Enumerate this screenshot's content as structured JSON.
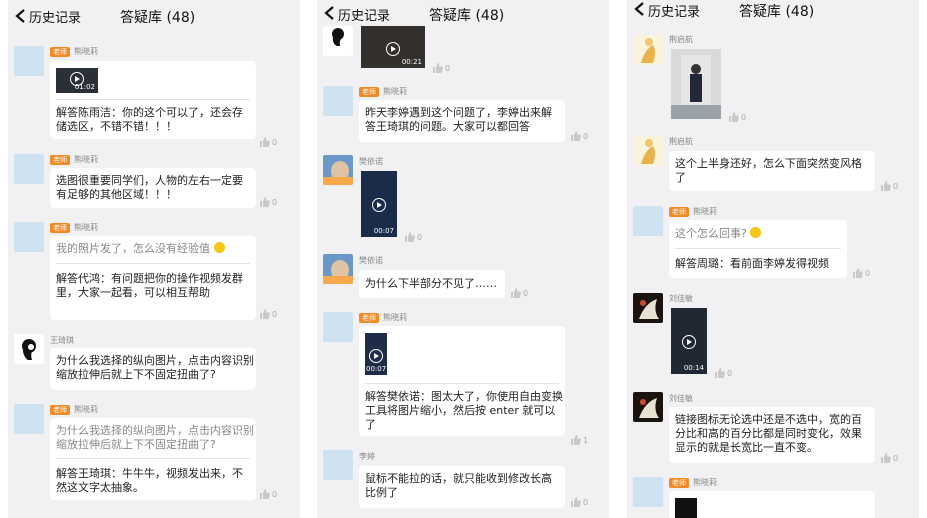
{
  "header": {
    "back_label": "历史记录",
    "title": "答疑库 (48)"
  },
  "teacher_tag": "老师",
  "like_count": "0",
  "panel1": {
    "items": [
      {
        "name": "熊晓莉",
        "video_duration": "01:02",
        "answer": "解答陈雨洁：你的这个可以了，还会存储选区，不错不错！！！",
        "likes": "0"
      },
      {
        "name": "熊晓莉",
        "text": "选图很重要同学们，人物的左右一定要有足够的其他区域！！！",
        "likes": "0"
      },
      {
        "name": "熊晓莉",
        "question": "我的照片发了，怎么没有经验值",
        "answer": "解答代鸿：有问题把你的操作视频发群里，大家一起看，可以相互帮助",
        "likes": "0"
      },
      {
        "name": "王琦琪",
        "text": "为什么我选择的纵向图片，点击内容识别缩放拉伸后就上下不固定扭曲了?"
      },
      {
        "name": "熊晓莉",
        "question": "为什么我选择的纵向图片，点击内容识别缩放拉伸后就上下不固定扭曲了?",
        "answer": "解答王琦琪：牛牛牛，视频发出来，不然这文字太抽象。",
        "likes": "0"
      }
    ]
  },
  "panel2": {
    "items": [
      {
        "video_duration": "00:21",
        "likes": "0"
      },
      {
        "name": "熊晓莉",
        "text": "昨天李婷遇到这个问题了，李婷出来解答王琦琪的问题。大家可以都回答",
        "likes": "0"
      },
      {
        "name": "樊依诺",
        "video_duration": "00:07",
        "likes": "0"
      },
      {
        "name": "樊依诺",
        "text": "为什么下半部分不见了……",
        "likes": "0"
      },
      {
        "name": "熊晓莉",
        "video_duration": "00:07",
        "answer": "解答樊依诺：图太大了，你使用自由变换工具将图片缩小，然后按 enter 就可以了",
        "likes": "1"
      },
      {
        "name": "李婷",
        "text": "鼠标不能拉的话，就只能收到修改长高比例了",
        "likes": "0"
      }
    ]
  },
  "panel3": {
    "items": [
      {
        "name": "荆启航",
        "likes": "0"
      },
      {
        "name": "荆启航",
        "text": "这个上半身还好，怎么下面突然变风格了",
        "likes": "0"
      },
      {
        "name": "熊晓莉",
        "question": "这个怎么回事?",
        "answer": "解答周璐：看前面李婷发得视频",
        "likes": "0"
      },
      {
        "name": "刘佳敏",
        "video_duration": "00:14",
        "likes": "0"
      },
      {
        "name": "刘佳敏",
        "text": "链接图标无论选中还是不选中，宽的百分比和高的百分比都是同时变化，效果显示的就是长宽比一直不变。",
        "likes": "0"
      },
      {
        "name": "熊晓莉"
      }
    ]
  }
}
